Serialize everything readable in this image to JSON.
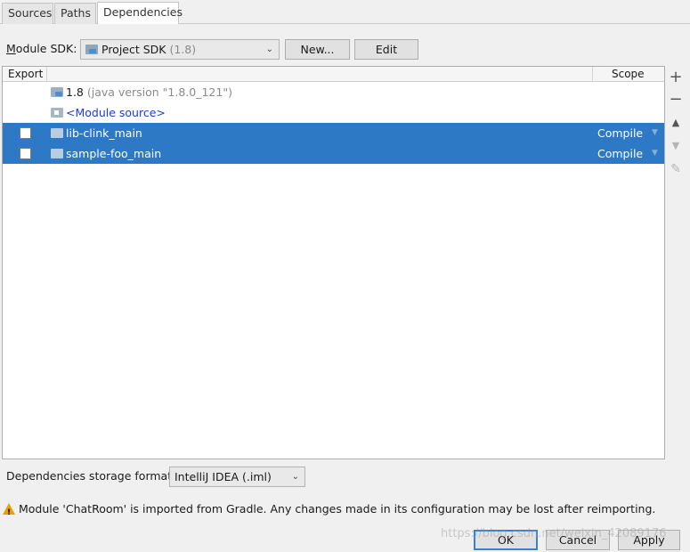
{
  "tabs": [
    {
      "label": "Sources"
    },
    {
      "label": "Paths"
    },
    {
      "label": "Dependencies"
    }
  ],
  "active_tab": "Dependencies",
  "sdk": {
    "label": "Module SDK:",
    "selected": "Project SDK",
    "version": "(1.8)",
    "new_label": "New...",
    "edit_label": "Edit"
  },
  "table": {
    "columns": {
      "export": "Export",
      "scope": "Scope"
    },
    "rows": [
      {
        "name": "1.8",
        "detail": "(java version \"1.8.0_121\")",
        "scope": "",
        "checked": false
      },
      {
        "name": "<Module source>",
        "detail": "",
        "scope": "",
        "checked": false
      },
      {
        "name": "lib-clink_main",
        "detail": "",
        "scope": "Compile",
        "checked": false
      },
      {
        "name": "sample-foo_main",
        "detail": "",
        "scope": "Compile",
        "checked": false
      }
    ]
  },
  "toolbar": {
    "add": "+",
    "remove": "−",
    "up": "▲",
    "down": "▼",
    "edit": "✎"
  },
  "storage": {
    "label": "Dependencies storage format:",
    "selected": "IntelliJ IDEA (.iml)"
  },
  "warning": {
    "text": "Module 'ChatRoom' is imported from Gradle. Any changes made in its configuration may be lost after reimporting."
  },
  "buttons": {
    "ok": "OK",
    "cancel": "Cancel",
    "apply": "Apply"
  },
  "watermark": "https://blog.csdn.net/weixin_42089176",
  "colors": {
    "selection": "#2d79c6",
    "link": "#1a3fd6",
    "warning": "#e8a100"
  }
}
